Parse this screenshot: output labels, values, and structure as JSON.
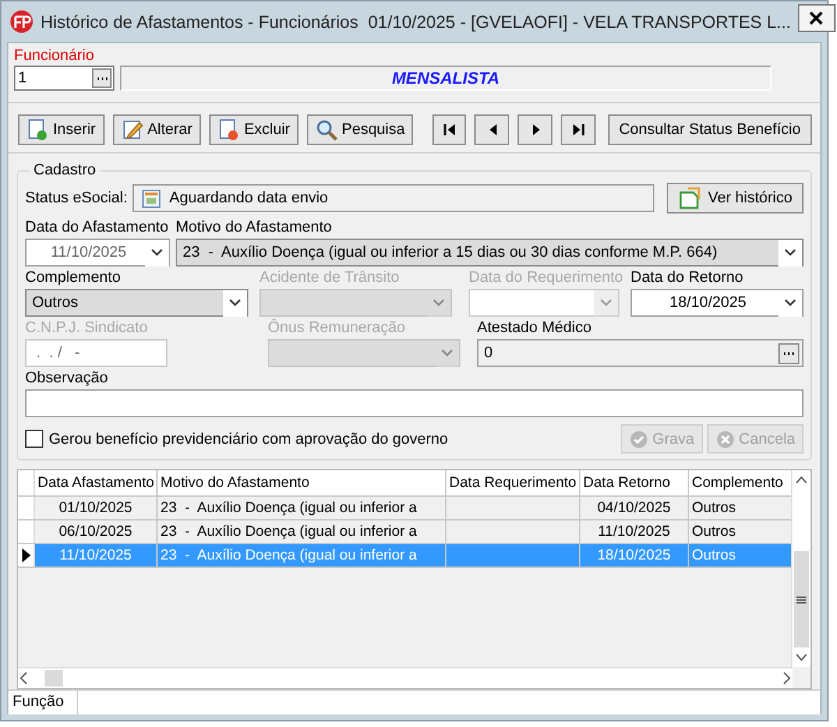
{
  "window": {
    "title": "Histórico de Afastamentos - Funcionários  01/10/2025 - [GVELAOFI] - VELA TRANSPORTES L..."
  },
  "employee": {
    "label": "Funcionário",
    "code": "1",
    "category": "MENSALISTA"
  },
  "toolbar": [
    {
      "kind": "text",
      "label": "Inserir"
    },
    {
      "kind": "text",
      "label": "Alterar"
    },
    {
      "kind": "text",
      "label": "Excluir"
    },
    {
      "kind": "text",
      "label": "Pesquisa"
    },
    {
      "kind": "nav"
    },
    {
      "kind": "nav"
    },
    {
      "kind": "nav"
    },
    {
      "kind": "nav"
    },
    {
      "kind": "plain",
      "label": "Consultar Status Benefício"
    }
  ],
  "cadastro": {
    "title": "Cadastro",
    "status_label": "Status eSocial:",
    "status_value": "Aguardando data envio",
    "history_button": "Ver histórico",
    "rows": [
      [
        {
          "kind": "date",
          "label": "Data do Afastamento",
          "value": "11/10/2025",
          "disabled": false
        },
        {
          "kind": "combo",
          "label": "Motivo do Afastamento",
          "value": "23  -  Auxílio Doença (igual ou inferior a 15 dias ou 30 dias conforme M.P. 664)",
          "disabled": false
        }
      ],
      [
        {
          "kind": "combo",
          "label": "Complemento",
          "value": "Outros",
          "disabled": false
        },
        {
          "kind": "combo",
          "label": "Acidente de Trânsito",
          "disabled": true
        },
        {
          "kind": "date",
          "label": "Data do Requerimento",
          "disabled": true
        },
        {
          "kind": "date",
          "label": "Data do Retorno",
          "value": "18/10/2025",
          "disabled": false
        }
      ],
      [
        {
          "kind": "text",
          "label": "C.N.P.J. Sindicato",
          "value": " .  . /   -",
          "disabled": true
        },
        {
          "kind": "combo",
          "label": "Ônus Remuneração",
          "disabled": true
        },
        {
          "kind": "lookup",
          "label": "Atestado Médico",
          "value": "0",
          "disabled": false
        }
      ],
      [
        {
          "kind": "text",
          "label": "Observação",
          "disabled": false
        }
      ]
    ],
    "checkbox": {
      "label": "Gerou benefício previdenciário com aprovação do governo",
      "checked": false
    },
    "actions": [
      {
        "label": "Grava",
        "disabled": true
      },
      {
        "label": "Cancela",
        "disabled": true
      }
    ]
  },
  "grid": {
    "columns": [
      "Data Afastamento",
      "Motivo do Afastamento",
      "Data Requerimento",
      "Data Retorno",
      "Complemento"
    ],
    "rows": [
      {
        "cells": [
          "01/10/2025",
          "23  -  Auxílio Doença (igual ou inferior a",
          "",
          "04/10/2025",
          "Outros"
        ],
        "selected": false
      },
      {
        "cells": [
          "06/10/2025",
          "23  -  Auxílio Doença (igual ou inferior a",
          "",
          "11/10/2025",
          "Outros"
        ],
        "selected": false
      },
      {
        "cells": [
          "11/10/2025",
          "23  -  Auxílio Doença (igual ou inferior a",
          "",
          "18/10/2025",
          "Outros"
        ],
        "selected": true
      }
    ]
  },
  "status_bar": {
    "text": "Função"
  }
}
